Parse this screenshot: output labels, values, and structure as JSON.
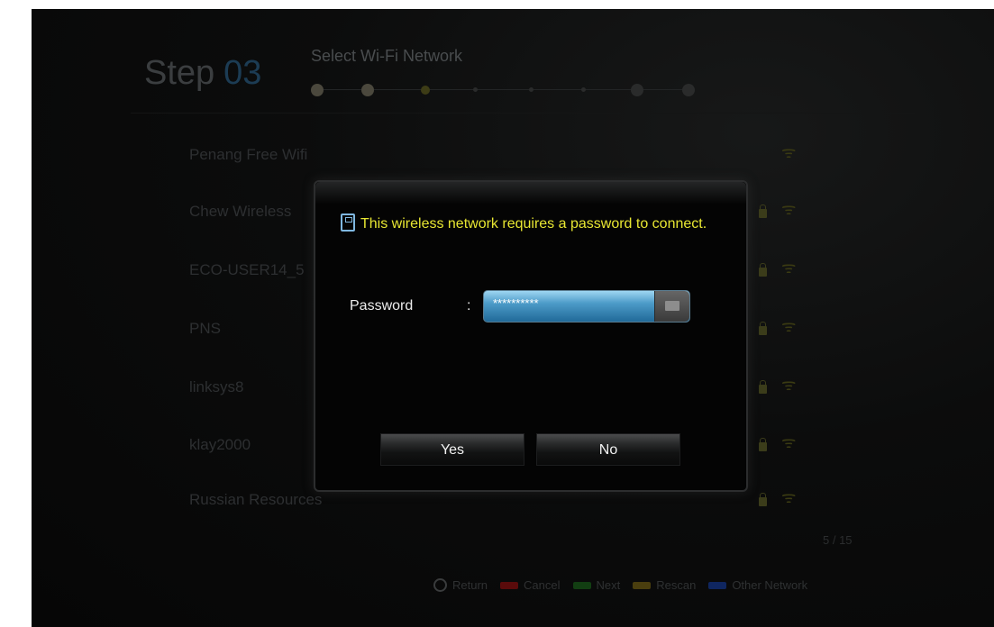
{
  "header": {
    "step_label": "Step",
    "step_number": "03",
    "title": "Select Wi-Fi Network"
  },
  "networks": [
    {
      "name": "Penang Free Wifi",
      "locked": false
    },
    {
      "name": "Chew Wireless",
      "locked": true
    },
    {
      "name": "ECO-USER14_5",
      "locked": true
    },
    {
      "name": "PNS",
      "locked": true
    },
    {
      "name": "linksys8",
      "locked": true
    },
    {
      "name": "klay2000",
      "locked": true
    },
    {
      "name": "Russian Resources",
      "locked": true
    }
  ],
  "page_counter": "5 / 15",
  "legend": {
    "return": "Return",
    "cancel": "Cancel",
    "next": "Next",
    "rescan": "Rescan",
    "other_network": "Other Network",
    "colors": {
      "cancel": "#5a0b0b",
      "next": "#123e12",
      "rescan": "#4a3e0e",
      "other_network": "#0f2660"
    }
  },
  "dialog": {
    "message": "This wireless network requires a password to connect.",
    "password_label": "Password",
    "colon": ":",
    "password_value": "**********",
    "yes_label": "Yes",
    "no_label": "No"
  },
  "icons": {
    "message": "memory-card-icon",
    "keyboard": "keyboard-icon",
    "lock": "lock-icon",
    "wifi": "wifi-signal-icon",
    "return": "return-icon"
  }
}
